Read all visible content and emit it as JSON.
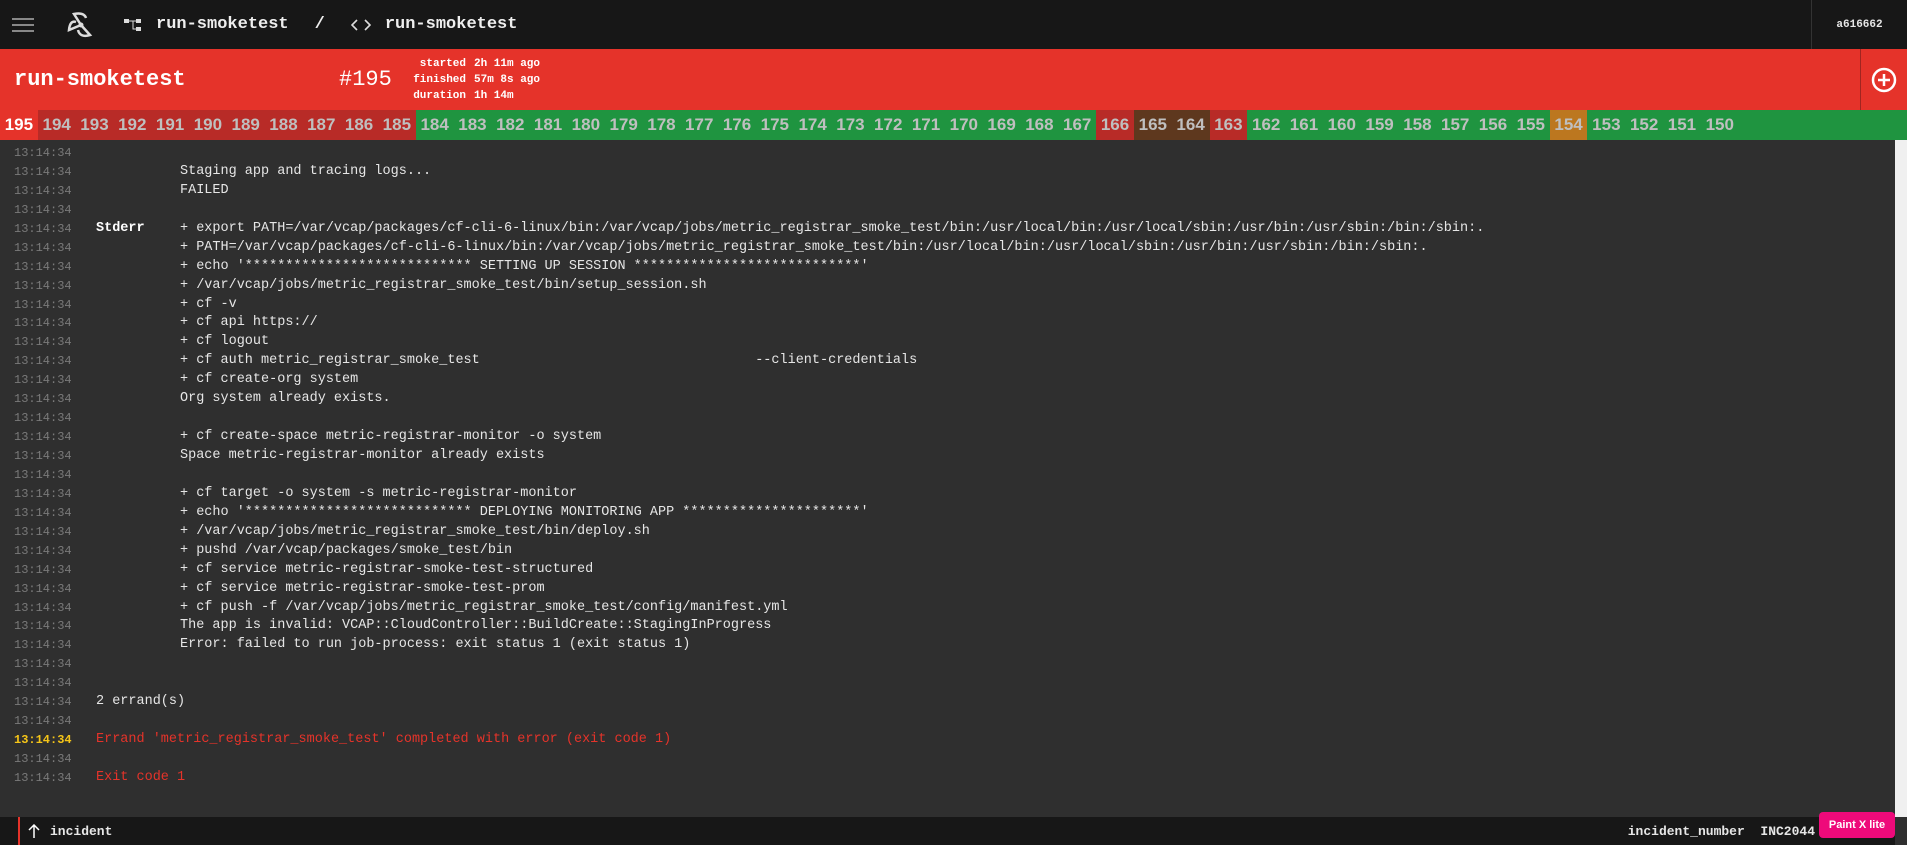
{
  "topbar": {
    "pipeline": "run-smoketest",
    "separator": "/",
    "job": "run-smoketest",
    "user": "a616662"
  },
  "header": {
    "job_name": "run-smoketest",
    "build": "#195",
    "started_label": "started",
    "started": "2h 11m ago",
    "finished_label": "finished",
    "finished": "57m 8s ago",
    "duration_label": "duration",
    "duration": "1h 14m"
  },
  "colors": {
    "current": "#e5332a",
    "failed": "#b82b27",
    "succeeded": "#1f9440",
    "errored": "#5e381e",
    "aborted": "#bc771f"
  },
  "builds": [
    {
      "n": "195",
      "s": "current"
    },
    {
      "n": "194",
      "s": "failed"
    },
    {
      "n": "193",
      "s": "failed"
    },
    {
      "n": "192",
      "s": "failed"
    },
    {
      "n": "191",
      "s": "failed"
    },
    {
      "n": "190",
      "s": "failed"
    },
    {
      "n": "189",
      "s": "failed"
    },
    {
      "n": "188",
      "s": "failed"
    },
    {
      "n": "187",
      "s": "failed"
    },
    {
      "n": "186",
      "s": "failed"
    },
    {
      "n": "185",
      "s": "failed"
    },
    {
      "n": "184",
      "s": "succeeded"
    },
    {
      "n": "183",
      "s": "succeeded"
    },
    {
      "n": "182",
      "s": "succeeded"
    },
    {
      "n": "181",
      "s": "succeeded"
    },
    {
      "n": "180",
      "s": "succeeded"
    },
    {
      "n": "179",
      "s": "succeeded"
    },
    {
      "n": "178",
      "s": "succeeded"
    },
    {
      "n": "177",
      "s": "succeeded"
    },
    {
      "n": "176",
      "s": "succeeded"
    },
    {
      "n": "175",
      "s": "succeeded"
    },
    {
      "n": "174",
      "s": "succeeded"
    },
    {
      "n": "173",
      "s": "succeeded"
    },
    {
      "n": "172",
      "s": "succeeded"
    },
    {
      "n": "171",
      "s": "succeeded"
    },
    {
      "n": "170",
      "s": "succeeded"
    },
    {
      "n": "169",
      "s": "succeeded"
    },
    {
      "n": "168",
      "s": "succeeded"
    },
    {
      "n": "167",
      "s": "succeeded"
    },
    {
      "n": "166",
      "s": "failed"
    },
    {
      "n": "165",
      "s": "errored"
    },
    {
      "n": "164",
      "s": "errored"
    },
    {
      "n": "163",
      "s": "failed"
    },
    {
      "n": "162",
      "s": "succeeded"
    },
    {
      "n": "161",
      "s": "succeeded"
    },
    {
      "n": "160",
      "s": "succeeded"
    },
    {
      "n": "159",
      "s": "succeeded"
    },
    {
      "n": "158",
      "s": "succeeded"
    },
    {
      "n": "157",
      "s": "succeeded"
    },
    {
      "n": "156",
      "s": "succeeded"
    },
    {
      "n": "155",
      "s": "succeeded"
    },
    {
      "n": "154",
      "s": "aborted"
    },
    {
      "n": "153",
      "s": "succeeded"
    },
    {
      "n": "152",
      "s": "succeeded"
    },
    {
      "n": "151",
      "s": "succeeded"
    },
    {
      "n": "150",
      "s": "succeeded"
    }
  ],
  "log": [
    {
      "ts": "13:14:34",
      "label": "",
      "text": ""
    },
    {
      "ts": "13:14:34",
      "label": "",
      "text": "Staging app and tracing logs..."
    },
    {
      "ts": "13:14:34",
      "label": "",
      "text": "FAILED"
    },
    {
      "ts": "13:14:34",
      "label": "",
      "text": ""
    },
    {
      "ts": "13:14:34",
      "label": "Stderr",
      "text": "+ export PATH=/var/vcap/packages/cf-cli-6-linux/bin:/var/vcap/jobs/metric_registrar_smoke_test/bin:/usr/local/bin:/usr/local/sbin:/usr/bin:/usr/sbin:/bin:/sbin:."
    },
    {
      "ts": "13:14:34",
      "label": "",
      "text": "+ PATH=/var/vcap/packages/cf-cli-6-linux/bin:/var/vcap/jobs/metric_registrar_smoke_test/bin:/usr/local/bin:/usr/local/sbin:/usr/bin:/usr/sbin:/bin:/sbin:."
    },
    {
      "ts": "13:14:34",
      "label": "",
      "text": "+ echo '**************************** SETTING UP SESSION ****************************'"
    },
    {
      "ts": "13:14:34",
      "label": "",
      "text": "+ /var/vcap/jobs/metric_registrar_smoke_test/bin/setup_session.sh"
    },
    {
      "ts": "13:14:34",
      "label": "",
      "text": "+ cf -v"
    },
    {
      "ts": "13:14:34",
      "label": "",
      "text": "+ cf api https://"
    },
    {
      "ts": "13:14:34",
      "label": "",
      "text": "+ cf logout"
    },
    {
      "ts": "13:14:34",
      "label": "",
      "text": "+ cf auth metric_registrar_smoke_test                                  --client-credentials"
    },
    {
      "ts": "13:14:34",
      "label": "",
      "text": "+ cf create-org system"
    },
    {
      "ts": "13:14:34",
      "label": "",
      "text": "Org system already exists."
    },
    {
      "ts": "13:14:34",
      "label": "",
      "text": ""
    },
    {
      "ts": "13:14:34",
      "label": "",
      "text": "+ cf create-space metric-registrar-monitor -o system"
    },
    {
      "ts": "13:14:34",
      "label": "",
      "text": "Space metric-registrar-monitor already exists"
    },
    {
      "ts": "13:14:34",
      "label": "",
      "text": ""
    },
    {
      "ts": "13:14:34",
      "label": "",
      "text": "+ cf target -o system -s metric-registrar-monitor"
    },
    {
      "ts": "13:14:34",
      "label": "",
      "text": "+ echo '**************************** DEPLOYING MONITORING APP **********************'"
    },
    {
      "ts": "13:14:34",
      "label": "",
      "text": "+ /var/vcap/jobs/metric_registrar_smoke_test/bin/deploy.sh"
    },
    {
      "ts": "13:14:34",
      "label": "",
      "text": "+ pushd /var/vcap/packages/smoke_test/bin"
    },
    {
      "ts": "13:14:34",
      "label": "",
      "text": "+ cf service metric-registrar-smoke-test-structured"
    },
    {
      "ts": "13:14:34",
      "label": "",
      "text": "+ cf service metric-registrar-smoke-test-prom"
    },
    {
      "ts": "13:14:34",
      "label": "",
      "text": "+ cf push -f /var/vcap/jobs/metric_registrar_smoke_test/config/manifest.yml"
    },
    {
      "ts": "13:14:34",
      "label": "",
      "text": "The app is invalid: VCAP::CloudController::BuildCreate::StagingInProgress"
    },
    {
      "ts": "13:14:34",
      "label": "",
      "text": "Error: failed to run job-process: exit status 1 (exit status 1)"
    },
    {
      "ts": "13:14:34",
      "label": "",
      "text": ""
    },
    {
      "ts": "13:14:34",
      "label": "",
      "text": ""
    },
    {
      "ts": "13:14:34",
      "label": "",
      "text": "2 errand(s)",
      "nolead": true
    },
    {
      "ts": "13:14:34",
      "label": "",
      "text": ""
    },
    {
      "ts": "13:14:34",
      "label": "",
      "text": "Errand 'metric_registrar_smoke_test' completed with error (exit code 1)",
      "nolead": true,
      "error": true,
      "highlight": true
    },
    {
      "ts": "13:14:34",
      "label": "",
      "text": ""
    },
    {
      "ts": "13:14:34",
      "label": "",
      "text": "Exit code 1",
      "nolead": true,
      "error": true
    }
  ],
  "footer": {
    "resource": "incident",
    "field": "incident_number",
    "value": "INC2044"
  },
  "badge": "Paint X lite"
}
